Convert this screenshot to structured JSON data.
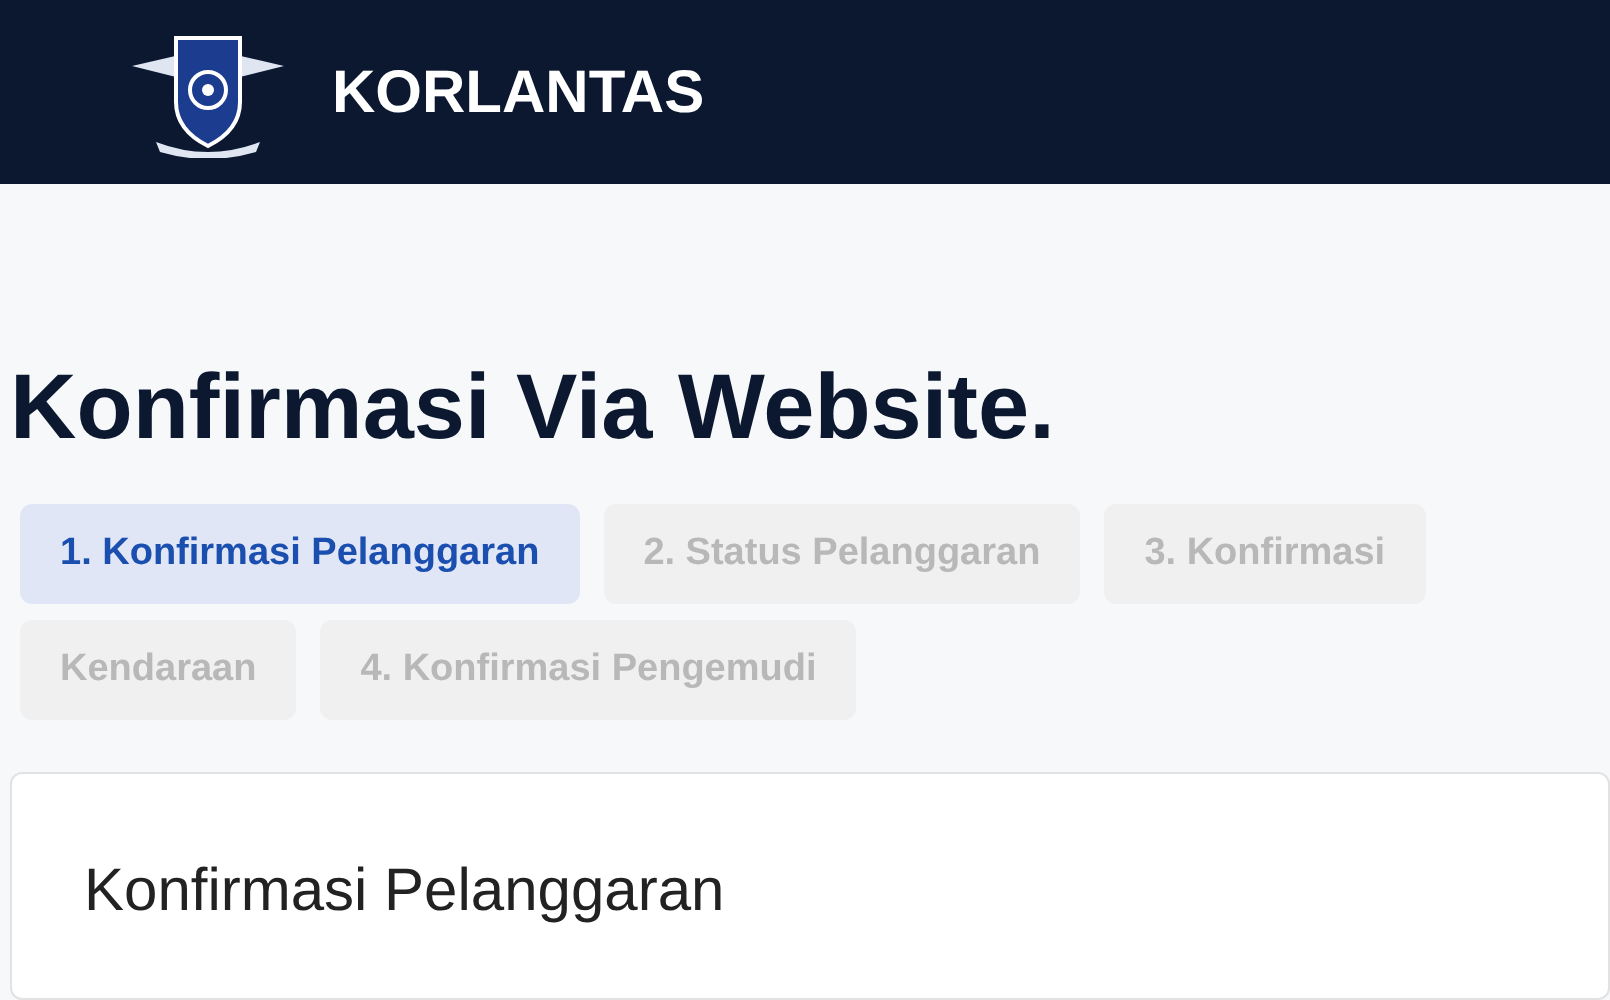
{
  "header": {
    "brand": "KORLANTAS"
  },
  "title": "Konfirmasi Via Website.",
  "tabs": [
    {
      "label_parts": [
        "1. Konfirmasi Pelanggaran"
      ],
      "selected": true
    },
    {
      "label_parts": [
        "2. Status Pelanggaran"
      ],
      "selected": false
    },
    {
      "label_parts": [
        "3. Konfirmasi",
        "Kendaraan"
      ],
      "selected": false
    },
    {
      "label_parts": [
        "4. Konfirmasi Pengemudi"
      ],
      "selected": false
    }
  ],
  "card": {
    "title": "Konfirmasi Pelanggaran"
  }
}
